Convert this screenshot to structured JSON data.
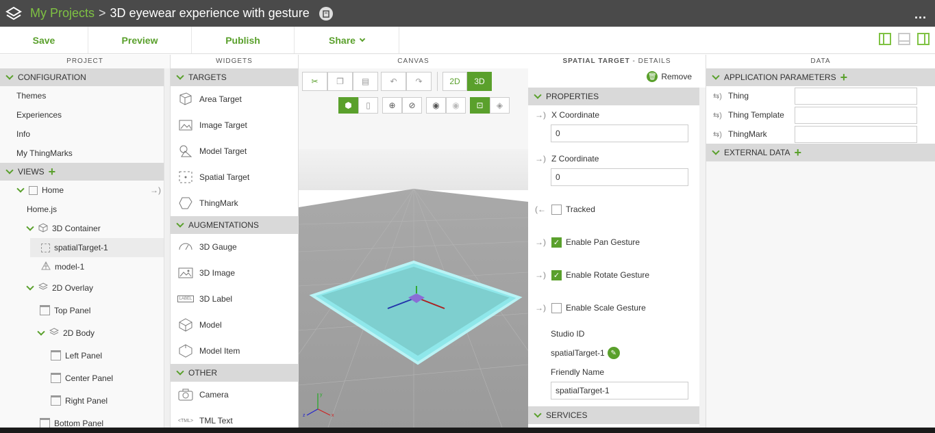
{
  "titlebar": {
    "breadcrumb_root": "My Projects",
    "separator": ">",
    "project_name": "3D eyewear experience with gesture",
    "menu_label": "..."
  },
  "toolbar": {
    "save": "Save",
    "preview": "Preview",
    "publish": "Publish",
    "share": "Share"
  },
  "project": {
    "title": "PROJECT",
    "configuration": "CONFIGURATION",
    "config_items": [
      "Themes",
      "Experiences",
      "Info",
      "My ThingMarks"
    ],
    "views": "VIEWS",
    "tree": {
      "home": "Home",
      "home_js": "Home.js",
      "container3d": "3D Container",
      "spatial_target": "spatialTarget-1",
      "model": "model-1",
      "overlay2d": "2D Overlay",
      "top_panel": "Top Panel",
      "body2d": "2D Body",
      "left_panel": "Left Panel",
      "center_panel": "Center Panel",
      "right_panel": "Right Panel",
      "bottom_panel": "Bottom Panel"
    }
  },
  "widgets": {
    "title": "WIDGETS",
    "targets": "TARGETS",
    "target_items": [
      "Area Target",
      "Image Target",
      "Model Target",
      "Spatial Target",
      "ThingMark"
    ],
    "augmentations": "AUGMENTATIONS",
    "augmentation_items": [
      "3D Gauge",
      "3D Image",
      "3D Label",
      "Model",
      "Model Item"
    ],
    "other": "OTHER",
    "other_items": [
      "Camera",
      "TML Text"
    ],
    "label_icon_text": "LABEL",
    "tml_icon_text": "<TML>"
  },
  "canvas": {
    "title": "CANVAS",
    "mode_2d": "2D",
    "mode_3d": "3D",
    "axis_x": "x",
    "axis_y": "y",
    "axis_z": "z"
  },
  "details": {
    "title_strong": "SPATIAL TARGET",
    "title_rest": " - DETAILS",
    "remove": "Remove",
    "properties": "PROPERTIES",
    "x_label": "X Coordinate",
    "x_value": "0",
    "z_label": "Z Coordinate",
    "z_value": "0",
    "tracked": "Tracked",
    "pan": "Enable Pan Gesture",
    "rotate": "Enable Rotate Gesture",
    "scale": "Enable Scale Gesture",
    "studio_id_label": "Studio ID",
    "studio_id_value": "spatialTarget-1",
    "friendly_label": "Friendly Name",
    "friendly_value": "spatialTarget-1",
    "services": "SERVICES"
  },
  "data": {
    "title": "DATA",
    "app_params": "APPLICATION PARAMETERS",
    "params": [
      "Thing",
      "Thing Template",
      "ThingMark"
    ],
    "external": "EXTERNAL DATA"
  },
  "colors": {
    "accent": "#5aa02c",
    "breadcrumb": "#7fc243",
    "titlebar": "#4a4a4a",
    "target_fill": "#7ecfcf"
  }
}
